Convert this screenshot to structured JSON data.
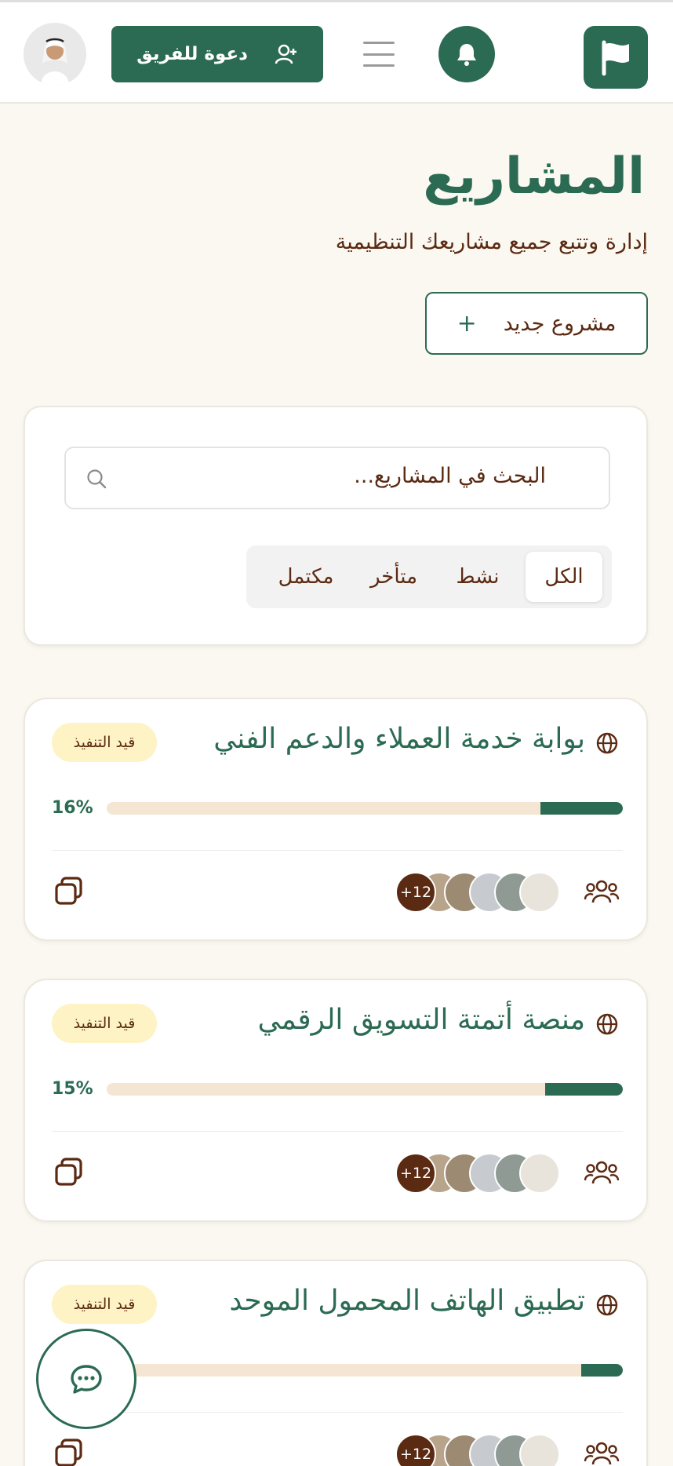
{
  "header": {
    "invite_label": "دعوة للفريق",
    "icons": [
      "flag-icon",
      "bell-icon",
      "menu-icon",
      "add-user-icon",
      "avatar"
    ]
  },
  "page": {
    "title": "المشاريع",
    "subtitle": "إدارة وتتبع جميع مشاريعك التنظيمية",
    "new_project_label": "مشروع جديد",
    "new_project_plus": "+"
  },
  "search": {
    "placeholder": "البحث في المشاريع..."
  },
  "filters": {
    "tabs": [
      "الكل",
      "نشط",
      "متأخر",
      "مكتمل"
    ],
    "active": "الكل"
  },
  "projects": [
    {
      "title": "بوابة خدمة العملاء والدعم الفني",
      "status": "قيد التنفيذ",
      "progress_label": "16%",
      "progress": 0.16,
      "more_members": "12+"
    },
    {
      "title": "منصة أتمتة التسويق الرقمي",
      "status": "قيد التنفيذ",
      "progress_label": "15%",
      "progress": 0.15,
      "more_members": "12+"
    },
    {
      "title": "تطبيق الهاتف المحمول الموحد",
      "status": "قيد التنفيذ",
      "progress_label": "",
      "progress": 0.08,
      "more_members": "12+"
    }
  ],
  "colors": {
    "primary": "#2c6b53",
    "brown": "#5b2a12",
    "background": "#fbf8f1",
    "badge": "#fdf3c4",
    "track": "#f5e6d3"
  }
}
